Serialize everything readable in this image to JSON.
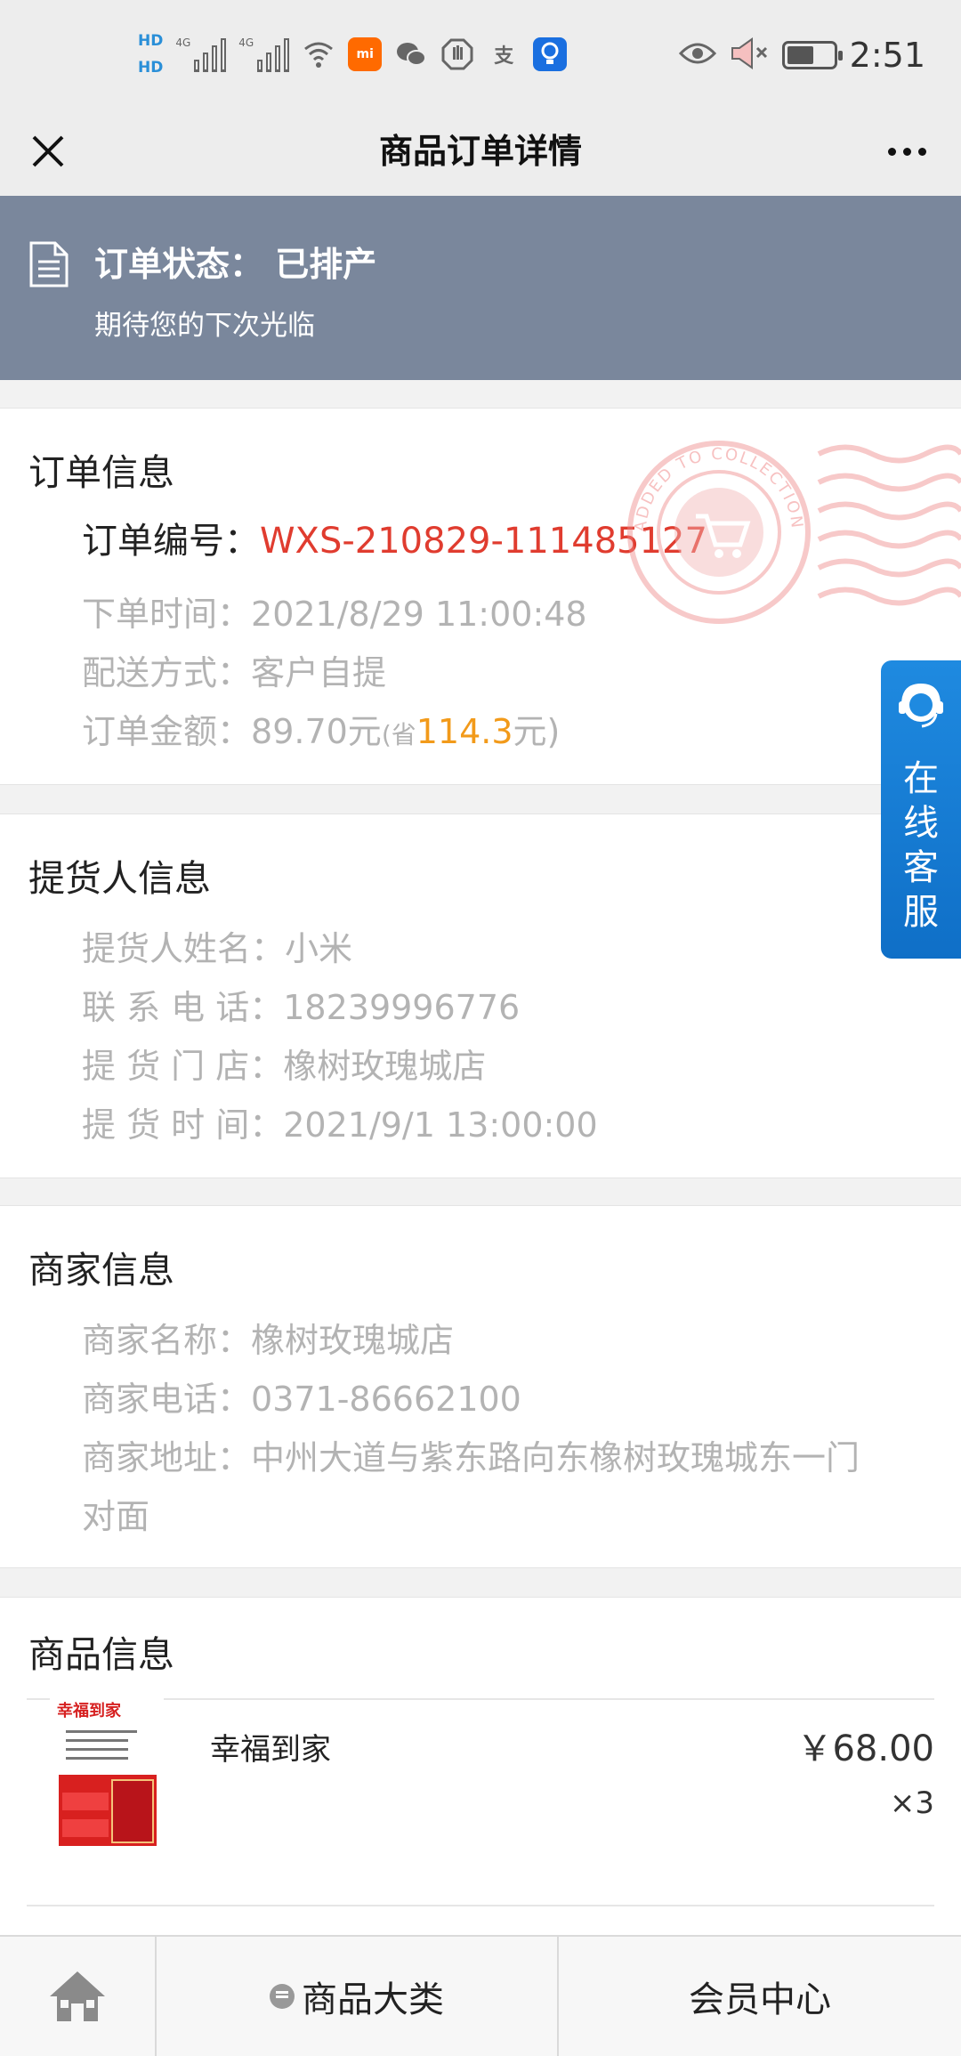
{
  "status_bar": {
    "hd1": "HD",
    "hd2": "HD",
    "net1": "4G",
    "net2": "4G",
    "alipay_glyph": "支",
    "mi_label": "mi",
    "time": "2:51"
  },
  "nav": {
    "title": "商品订单详情"
  },
  "banner": {
    "status_label": "订单状态：",
    "status_value": "已排产",
    "message": "期待您的下次光临"
  },
  "order_info": {
    "title": "订单信息",
    "order_no_label": "订单编号：",
    "order_no": "WXS-210829-111485127",
    "time_label": "下单时间：",
    "time": "2021/8/29 11:00:48",
    "delivery_label": "配送方式：",
    "delivery": "客户自提",
    "amount_label": "订单金额：",
    "amount": "89.70元",
    "saved_open": "(省",
    "saved": "114.3",
    "saved_close": "元)"
  },
  "pickup_info": {
    "title": "提货人信息",
    "name_label": "提货人姓名：",
    "name": "小米",
    "phone_label": "联 系 电 话：",
    "phone": "18239996776",
    "store_label": "提 货 门 店：",
    "store": "橡树玫瑰城店",
    "time_label": "提 货 时 间：",
    "time": "2021/9/1 13:00:00"
  },
  "merchant_info": {
    "title": "商家信息",
    "name_label": "商家名称：",
    "name": "橡树玫瑰城店",
    "phone_label": "商家电话：",
    "phone": "0371-86662100",
    "address_label": "商家地址：",
    "address_line1": "中州大道与紫东路向东橡树玫瑰城东一门",
    "address_line2": "对面"
  },
  "product_info": {
    "title": "商品信息",
    "items": [
      {
        "name": "幸福到家",
        "price": "￥68.00",
        "qty": "×3",
        "image_title": "幸福到家"
      }
    ]
  },
  "stamp_text": "ADDED TO COLLECTION",
  "service": {
    "chars": [
      "在",
      "线",
      "客",
      "服"
    ]
  },
  "tabbar": {
    "home_icon": "home-icon",
    "category_label": "商品大类",
    "member_label": "会员中心"
  },
  "colors": {
    "banner": "#7a879c",
    "order_no": "#e03c2f",
    "saved": "#f29a1a",
    "service": "#1f8ae0"
  }
}
